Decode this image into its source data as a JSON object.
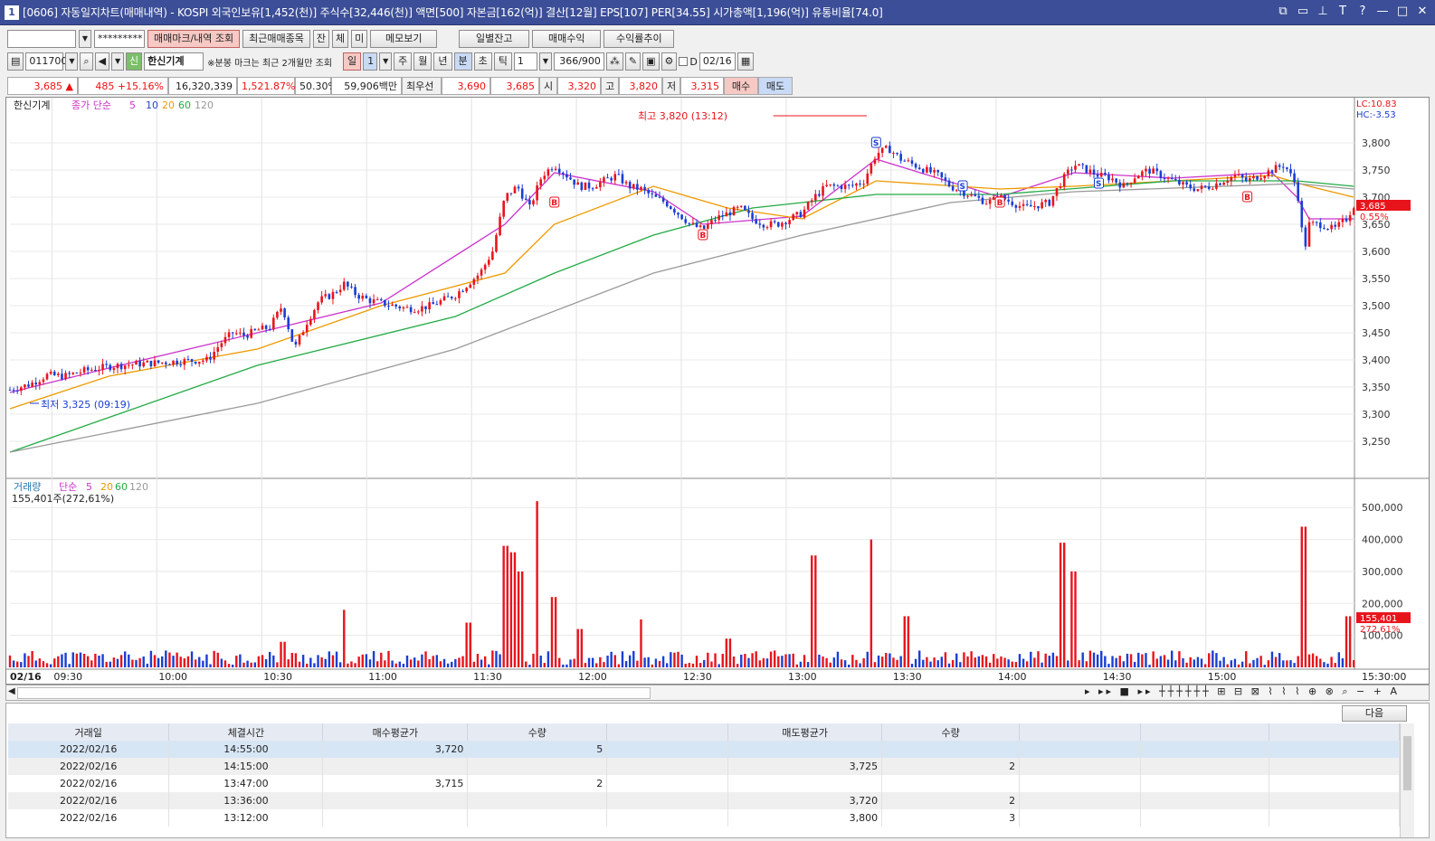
{
  "window": {
    "num": "1",
    "title": "[0606] 자동일지차트(매매내역) - KOSPI 외국인보유[1,452(천)] 주식수[32,446(천)] 액면[500] 자본금[162(억)] 결산[12월] EPS[107] PER[34.55] 시가총액[1,196(억)] 유통비율[74.0]",
    "icons": [
      "restore-icon",
      "window-icon",
      "pin-icon",
      "T",
      "?",
      "minimize-icon",
      "maximize-icon",
      "close-icon"
    ]
  },
  "toolbar1": {
    "account": "",
    "password": "*********",
    "buttons": [
      "매매마크/내역 조회",
      "최근매매종목",
      "잔",
      "체",
      "미",
      "메모보기"
    ],
    "right_buttons": [
      "일별잔고",
      "매매수익",
      "수익률추이"
    ]
  },
  "toolbar2": {
    "code": "011700",
    "stock": "한신기계",
    "note": "※분봉 마크는 최근 2개월만 조회",
    "periods": [
      "일",
      "주",
      "월",
      "년",
      "분",
      "초",
      "틱"
    ],
    "period_num": "1",
    "interval": "1",
    "count": "366/900",
    "date": "02/16",
    "d_label": "D"
  },
  "quote": {
    "price": "3,685",
    "arrow": "▲",
    "change": "485",
    "rate": "+15.16%",
    "volume": "16,320,339",
    "vol_rate": "1,521.87%",
    "ratio": "50.30%",
    "amount": "59,906백만",
    "best": "최우선",
    "bid1": "3,690",
    "bid2": "3,685",
    "open_label": "시",
    "open": "3,320",
    "high_label": "고",
    "high": "3,820",
    "low_label": "저",
    "low": "3,315",
    "buy": "매수",
    "sell": "매도"
  },
  "chart_data": {
    "type": "candlestick",
    "price_panel": {
      "legend": {
        "name": "한신기계",
        "ma_label": "종가 단순",
        "periods": [
          "5",
          "10",
          "20",
          "60",
          "120"
        ],
        "colors": [
          "#cc33cc",
          "#2244cc",
          "#ee9900",
          "#22aa44",
          "#999999"
        ]
      },
      "ylim": [
        3200,
        3850
      ],
      "yticks": [
        "3,800",
        "3,750",
        "3,700",
        "3,650",
        "3,600",
        "3,550",
        "3,500",
        "3,450",
        "3,400",
        "3,350",
        "3,300",
        "3,250"
      ],
      "lc": "LC:10.83",
      "hc": "HC:-3.53",
      "current": "3,685",
      "current_pct": "0.55%",
      "max_label": "최고 3,820 (13:12)",
      "min_label": "최저 3,325 (09:19)",
      "close_path": [
        [
          0,
          3345
        ],
        [
          8,
          3355
        ],
        [
          15,
          3372
        ],
        [
          22,
          3370
        ],
        [
          30,
          3380
        ],
        [
          40,
          3388
        ],
        [
          50,
          3392
        ],
        [
          60,
          3395
        ],
        [
          70,
          3398
        ],
        [
          80,
          3400
        ],
        [
          85,
          3430
        ],
        [
          90,
          3450
        ],
        [
          95,
          3445
        ],
        [
          100,
          3455
        ],
        [
          105,
          3460
        ],
        [
          110,
          3500
        ],
        [
          115,
          3420
        ],
        [
          120,
          3470
        ],
        [
          125,
          3510
        ],
        [
          130,
          3520
        ],
        [
          135,
          3540
        ],
        [
          140,
          3520
        ],
        [
          145,
          3510
        ],
        [
          150,
          3505
        ],
        [
          155,
          3500
        ],
        [
          160,
          3495
        ],
        [
          165,
          3495
        ],
        [
          170,
          3500
        ],
        [
          175,
          3510
        ],
        [
          180,
          3520
        ],
        [
          185,
          3540
        ],
        [
          190,
          3560
        ],
        [
          195,
          3600
        ],
        [
          200,
          3700
        ],
        [
          205,
          3720
        ],
        [
          210,
          3680
        ],
        [
          215,
          3740
        ],
        [
          220,
          3760
        ],
        [
          225,
          3740
        ],
        [
          230,
          3720
        ],
        [
          235,
          3720
        ],
        [
          240,
          3730
        ],
        [
          245,
          3740
        ],
        [
          250,
          3720
        ],
        [
          255,
          3715
        ],
        [
          260,
          3700
        ],
        [
          265,
          3690
        ],
        [
          270,
          3670
        ],
        [
          275,
          3650
        ],
        [
          280,
          3640
        ],
        [
          285,
          3660
        ],
        [
          290,
          3670
        ],
        [
          295,
          3680
        ],
        [
          300,
          3660
        ],
        [
          305,
          3650
        ],
        [
          310,
          3650
        ],
        [
          315,
          3660
        ],
        [
          320,
          3670
        ],
        [
          325,
          3700
        ],
        [
          330,
          3720
        ],
        [
          335,
          3720
        ],
        [
          340,
          3720
        ],
        [
          345,
          3730
        ],
        [
          350,
          3780
        ],
        [
          355,
          3790
        ],
        [
          360,
          3770
        ],
        [
          365,
          3760
        ],
        [
          370,
          3750
        ],
        [
          375,
          3740
        ],
        [
          380,
          3720
        ],
        [
          385,
          3710
        ],
        [
          390,
          3700
        ],
        [
          395,
          3690
        ],
        [
          400,
          3700
        ],
        [
          405,
          3690
        ],
        [
          410,
          3680
        ],
        [
          415,
          3685
        ],
        [
          420,
          3690
        ],
        [
          425,
          3730
        ],
        [
          430,
          3760
        ],
        [
          435,
          3750
        ],
        [
          440,
          3740
        ],
        [
          445,
          3735
        ],
        [
          450,
          3720
        ],
        [
          455,
          3740
        ],
        [
          460,
          3750
        ],
        [
          465,
          3740
        ],
        [
          470,
          3730
        ],
        [
          475,
          3720
        ],
        [
          480,
          3715
        ],
        [
          485,
          3720
        ],
        [
          490,
          3730
        ],
        [
          495,
          3740
        ],
        [
          500,
          3730
        ],
        [
          505,
          3740
        ],
        [
          510,
          3750
        ],
        [
          515,
          3760
        ],
        [
          520,
          3720
        ],
        [
          523,
          3600
        ],
        [
          525,
          3650
        ],
        [
          530,
          3650
        ],
        [
          535,
          3640
        ],
        [
          540,
          3660
        ],
        [
          543,
          3685
        ]
      ],
      "ma_paths": {
        "ma5": [
          [
            0,
            3340
          ],
          [
            40,
            3385
          ],
          [
            100,
            3450
          ],
          [
            150,
            3505
          ],
          [
            200,
            3650
          ],
          [
            220,
            3745
          ],
          [
            260,
            3710
          ],
          [
            280,
            3650
          ],
          [
            320,
            3665
          ],
          [
            350,
            3770
          ],
          [
            400,
            3700
          ],
          [
            430,
            3745
          ],
          [
            470,
            3735
          ],
          [
            510,
            3745
          ],
          [
            520,
            3700
          ],
          [
            525,
            3660
          ],
          [
            543,
            3660
          ]
        ],
        "ma20": [
          [
            0,
            3310
          ],
          [
            40,
            3370
          ],
          [
            100,
            3420
          ],
          [
            150,
            3500
          ],
          [
            200,
            3560
          ],
          [
            220,
            3650
          ],
          [
            260,
            3720
          ],
          [
            290,
            3680
          ],
          [
            320,
            3660
          ],
          [
            350,
            3730
          ],
          [
            400,
            3715
          ],
          [
            430,
            3720
          ],
          [
            470,
            3730
          ],
          [
            510,
            3740
          ],
          [
            525,
            3720
          ],
          [
            543,
            3700
          ]
        ],
        "ma60": [
          [
            0,
            3230
          ],
          [
            100,
            3390
          ],
          [
            180,
            3480
          ],
          [
            220,
            3560
          ],
          [
            260,
            3630
          ],
          [
            300,
            3680
          ],
          [
            350,
            3705
          ],
          [
            400,
            3705
          ],
          [
            470,
            3730
          ],
          [
            520,
            3730
          ],
          [
            543,
            3720
          ]
        ],
        "ma120": [
          [
            0,
            3230
          ],
          [
            100,
            3320
          ],
          [
            180,
            3420
          ],
          [
            260,
            3560
          ],
          [
            320,
            3630
          ],
          [
            380,
            3690
          ],
          [
            430,
            3710
          ],
          [
            520,
            3725
          ],
          [
            543,
            3715
          ]
        ]
      },
      "trade_marks": [
        {
          "t": 220,
          "p": 3690,
          "type": "B"
        },
        {
          "t": 280,
          "p": 3630,
          "type": "B"
        },
        {
          "t": 350,
          "p": 3800,
          "type": "S"
        },
        {
          "t": 385,
          "p": 3720,
          "type": "S"
        },
        {
          "t": 400,
          "p": 3690,
          "type": "B"
        },
        {
          "t": 440,
          "p": 3725,
          "type": "S"
        },
        {
          "t": 500,
          "p": 3700,
          "type": "B"
        }
      ]
    },
    "volume_panel": {
      "legend": {
        "name": "거래량",
        "ma_label": "단순",
        "periods": [
          "5",
          "20",
          "60",
          "120"
        ]
      },
      "current_label": "155,401주(272,61%)",
      "ylim": [
        0,
        560000
      ],
      "yticks": [
        "500,000",
        "400,000",
        "300,000",
        "200,000",
        "100,000"
      ],
      "current": "155,401",
      "current_pct": "272.61%",
      "spikes": [
        [
          110,
          80000
        ],
        [
          135,
          180000
        ],
        [
          185,
          140000
        ],
        [
          200,
          380000
        ],
        [
          203,
          360000
        ],
        [
          206,
          300000
        ],
        [
          213,
          520000
        ],
        [
          220,
          220000
        ],
        [
          230,
          120000
        ],
        [
          255,
          150000
        ],
        [
          290,
          90000
        ],
        [
          325,
          350000
        ],
        [
          348,
          400000
        ],
        [
          362,
          160000
        ],
        [
          425,
          390000
        ],
        [
          430,
          300000
        ],
        [
          523,
          440000
        ],
        [
          541,
          160000
        ]
      ]
    },
    "x_labels": [
      "02/16",
      "09:30",
      "10:00",
      "10:30",
      "11:00",
      "11:30",
      "12:00",
      "12:30",
      "13:00",
      "13:30",
      "14:00",
      "14:30",
      "15:00",
      "15:30:00"
    ]
  },
  "grid": {
    "headers": [
      "거래일",
      "체결시간",
      "매수평균가",
      "수량",
      "",
      "매도평균가",
      "수량",
      "",
      "",
      ""
    ],
    "next": "다음",
    "rows": [
      [
        "2022/02/16",
        "14:55:00",
        "3,720",
        "5",
        "",
        "",
        "",
        "",
        "",
        ""
      ],
      [
        "2022/02/16",
        "14:15:00",
        "",
        "",
        "",
        "3,725",
        "2",
        "",
        "",
        ""
      ],
      [
        "2022/02/16",
        "13:47:00",
        "3,715",
        "2",
        "",
        "",
        "",
        "",
        "",
        ""
      ],
      [
        "2022/02/16",
        "13:36:00",
        "",
        "",
        "",
        "3,720",
        "2",
        "",
        "",
        ""
      ],
      [
        "2022/02/16",
        "13:12:00",
        "",
        "",
        "",
        "3,800",
        "3",
        "",
        "",
        ""
      ]
    ]
  }
}
